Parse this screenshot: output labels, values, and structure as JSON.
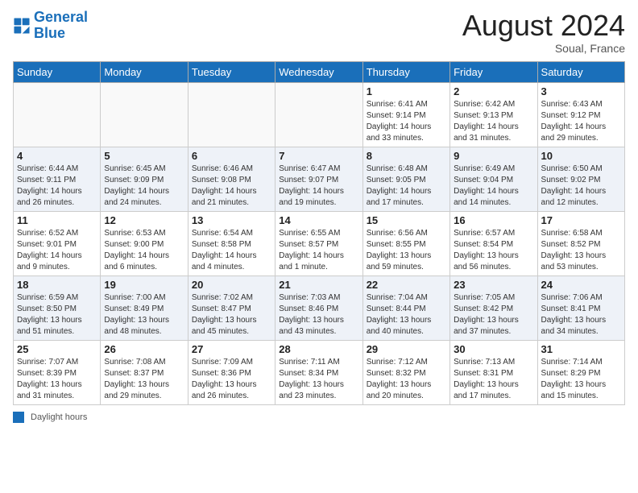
{
  "header": {
    "logo_general": "General",
    "logo_blue": "Blue",
    "month_year": "August 2024",
    "location": "Soual, France"
  },
  "days_of_week": [
    "Sunday",
    "Monday",
    "Tuesday",
    "Wednesday",
    "Thursday",
    "Friday",
    "Saturday"
  ],
  "weeks": [
    [
      {
        "day": "",
        "info": ""
      },
      {
        "day": "",
        "info": ""
      },
      {
        "day": "",
        "info": ""
      },
      {
        "day": "",
        "info": ""
      },
      {
        "day": "1",
        "info": "Sunrise: 6:41 AM\nSunset: 9:14 PM\nDaylight: 14 hours and 33 minutes."
      },
      {
        "day": "2",
        "info": "Sunrise: 6:42 AM\nSunset: 9:13 PM\nDaylight: 14 hours and 31 minutes."
      },
      {
        "day": "3",
        "info": "Sunrise: 6:43 AM\nSunset: 9:12 PM\nDaylight: 14 hours and 29 minutes."
      }
    ],
    [
      {
        "day": "4",
        "info": "Sunrise: 6:44 AM\nSunset: 9:11 PM\nDaylight: 14 hours and 26 minutes."
      },
      {
        "day": "5",
        "info": "Sunrise: 6:45 AM\nSunset: 9:09 PM\nDaylight: 14 hours and 24 minutes."
      },
      {
        "day": "6",
        "info": "Sunrise: 6:46 AM\nSunset: 9:08 PM\nDaylight: 14 hours and 21 minutes."
      },
      {
        "day": "7",
        "info": "Sunrise: 6:47 AM\nSunset: 9:07 PM\nDaylight: 14 hours and 19 minutes."
      },
      {
        "day": "8",
        "info": "Sunrise: 6:48 AM\nSunset: 9:05 PM\nDaylight: 14 hours and 17 minutes."
      },
      {
        "day": "9",
        "info": "Sunrise: 6:49 AM\nSunset: 9:04 PM\nDaylight: 14 hours and 14 minutes."
      },
      {
        "day": "10",
        "info": "Sunrise: 6:50 AM\nSunset: 9:02 PM\nDaylight: 14 hours and 12 minutes."
      }
    ],
    [
      {
        "day": "11",
        "info": "Sunrise: 6:52 AM\nSunset: 9:01 PM\nDaylight: 14 hours and 9 minutes."
      },
      {
        "day": "12",
        "info": "Sunrise: 6:53 AM\nSunset: 9:00 PM\nDaylight: 14 hours and 6 minutes."
      },
      {
        "day": "13",
        "info": "Sunrise: 6:54 AM\nSunset: 8:58 PM\nDaylight: 14 hours and 4 minutes."
      },
      {
        "day": "14",
        "info": "Sunrise: 6:55 AM\nSunset: 8:57 PM\nDaylight: 14 hours and 1 minute."
      },
      {
        "day": "15",
        "info": "Sunrise: 6:56 AM\nSunset: 8:55 PM\nDaylight: 13 hours and 59 minutes."
      },
      {
        "day": "16",
        "info": "Sunrise: 6:57 AM\nSunset: 8:54 PM\nDaylight: 13 hours and 56 minutes."
      },
      {
        "day": "17",
        "info": "Sunrise: 6:58 AM\nSunset: 8:52 PM\nDaylight: 13 hours and 53 minutes."
      }
    ],
    [
      {
        "day": "18",
        "info": "Sunrise: 6:59 AM\nSunset: 8:50 PM\nDaylight: 13 hours and 51 minutes."
      },
      {
        "day": "19",
        "info": "Sunrise: 7:00 AM\nSunset: 8:49 PM\nDaylight: 13 hours and 48 minutes."
      },
      {
        "day": "20",
        "info": "Sunrise: 7:02 AM\nSunset: 8:47 PM\nDaylight: 13 hours and 45 minutes."
      },
      {
        "day": "21",
        "info": "Sunrise: 7:03 AM\nSunset: 8:46 PM\nDaylight: 13 hours and 43 minutes."
      },
      {
        "day": "22",
        "info": "Sunrise: 7:04 AM\nSunset: 8:44 PM\nDaylight: 13 hours and 40 minutes."
      },
      {
        "day": "23",
        "info": "Sunrise: 7:05 AM\nSunset: 8:42 PM\nDaylight: 13 hours and 37 minutes."
      },
      {
        "day": "24",
        "info": "Sunrise: 7:06 AM\nSunset: 8:41 PM\nDaylight: 13 hours and 34 minutes."
      }
    ],
    [
      {
        "day": "25",
        "info": "Sunrise: 7:07 AM\nSunset: 8:39 PM\nDaylight: 13 hours and 31 minutes."
      },
      {
        "day": "26",
        "info": "Sunrise: 7:08 AM\nSunset: 8:37 PM\nDaylight: 13 hours and 29 minutes."
      },
      {
        "day": "27",
        "info": "Sunrise: 7:09 AM\nSunset: 8:36 PM\nDaylight: 13 hours and 26 minutes."
      },
      {
        "day": "28",
        "info": "Sunrise: 7:11 AM\nSunset: 8:34 PM\nDaylight: 13 hours and 23 minutes."
      },
      {
        "day": "29",
        "info": "Sunrise: 7:12 AM\nSunset: 8:32 PM\nDaylight: 13 hours and 20 minutes."
      },
      {
        "day": "30",
        "info": "Sunrise: 7:13 AM\nSunset: 8:31 PM\nDaylight: 13 hours and 17 minutes."
      },
      {
        "day": "31",
        "info": "Sunrise: 7:14 AM\nSunset: 8:29 PM\nDaylight: 13 hours and 15 minutes."
      }
    ]
  ],
  "legend": {
    "label": "Daylight hours"
  }
}
